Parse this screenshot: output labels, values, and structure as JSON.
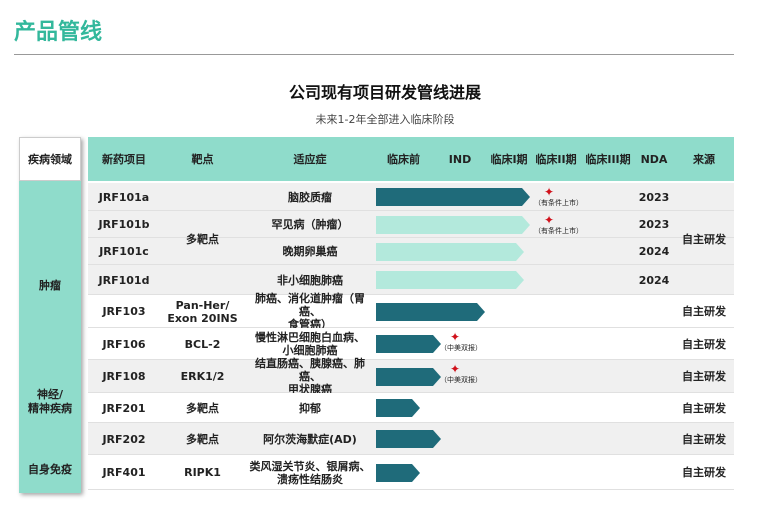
{
  "slide": {
    "title": "产品管线"
  },
  "chart": {
    "title": "公司现有项目研发管线进展",
    "subtitle": "未来1-2年全部进入临床阶段"
  },
  "left_column": {
    "header": "疾病领域",
    "groups": [
      "肿瘤",
      "神经/\n精神疾病",
      "自身免疫"
    ]
  },
  "headers": [
    "新药项目",
    "靶点",
    "适应症",
    "临床前",
    "IND",
    "临床I期",
    "临床II期",
    "临床III期",
    "NDA",
    "来源"
  ],
  "rows": [
    {
      "project": "JRF101a",
      "target": "",
      "indication": "脑胶质瘤",
      "nda": "2023",
      "stage": "phase2",
      "light": false,
      "star": "（有条件上市）"
    },
    {
      "project": "JRF101b",
      "target": "",
      "indication": "罕见病（肿瘤）",
      "nda": "2023",
      "stage": "phase2",
      "light": true,
      "star": "（有条件上市）"
    },
    {
      "project": "JRF101c",
      "target": "",
      "indication": "晚期卵巢癌",
      "nda": "2024",
      "stage": "phase1",
      "light": true,
      "star": ""
    },
    {
      "project": "JRF101d",
      "target": "",
      "indication": "非小细胞肺癌",
      "nda": "2024",
      "stage": "phase1",
      "light": true,
      "star": ""
    },
    {
      "project": "JRF103",
      "target": "Pan-Her/\nExon 20INS",
      "indication": "肺癌、消化道肿瘤（胃癌、\n食管癌）",
      "nda": "",
      "stage": "ind",
      "light": false,
      "star": ""
    },
    {
      "project": "JRF106",
      "target": "BCL-2",
      "indication": "慢性淋巴细胞白血病、\n小细胞肺癌",
      "nda": "",
      "stage": "ind-early",
      "light": false,
      "star": "（中美双报）"
    },
    {
      "project": "JRF108",
      "target": "ERK1/2",
      "indication": "结直肠癌、胰腺癌、肺癌、\n甲状腺癌",
      "nda": "",
      "stage": "ind-early",
      "light": false,
      "star": "（中美双报）"
    },
    {
      "project": "JRF201",
      "target": "多靶点",
      "indication": "抑郁",
      "nda": "",
      "stage": "preclinical",
      "light": false,
      "star": ""
    },
    {
      "project": "JRF202",
      "target": "多靶点",
      "indication": "阿尔茨海默症(AD)",
      "nda": "",
      "stage": "ind-early",
      "light": false,
      "star": ""
    },
    {
      "project": "JRF401",
      "target": "RIPK1",
      "indication": "类风湿关节炎、银屑病、\n溃疡性结肠炎",
      "nda": "",
      "stage": "preclinical",
      "light": false,
      "star": ""
    }
  ],
  "merged": {
    "target_101": "多靶点",
    "source_101": "自主研发"
  },
  "sources": [
    "自主研发",
    "自主研发",
    "自主研发",
    "自主研发",
    "自主研发",
    "自主研发"
  ],
  "colors": {
    "accent": "#33b89c",
    "header_bg": "#8fdccb",
    "bar_dark": "#1f6b7a",
    "bar_light": "#b3e9dc",
    "star": "#d0111b"
  }
}
